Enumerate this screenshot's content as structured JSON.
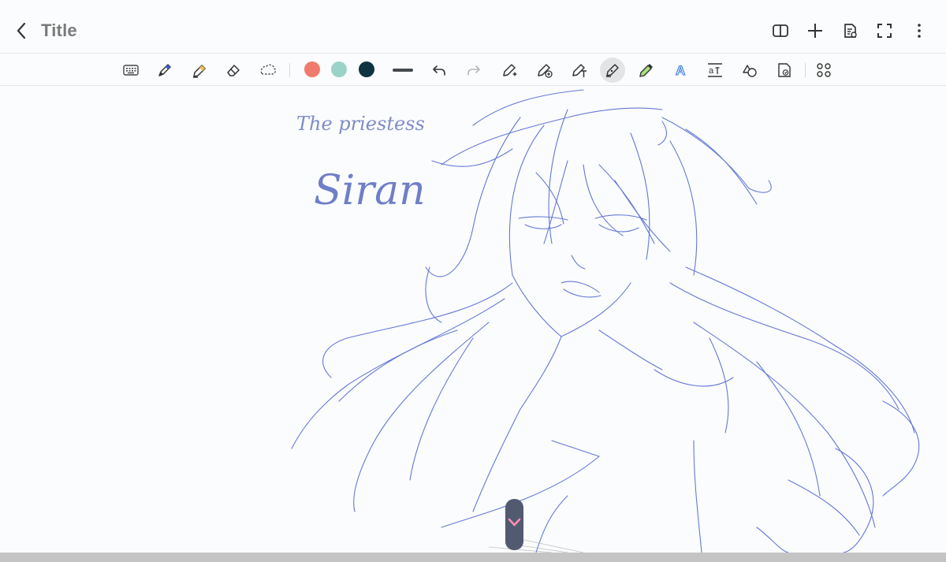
{
  "header": {
    "title": "Title",
    "actions": [
      "book-icon",
      "add-icon",
      "page-settings-icon",
      "fullscreen-icon",
      "more-icon"
    ]
  },
  "toolbar": {
    "tools": [
      "keyboard-icon",
      "pen-icon",
      "highlighter-icon",
      "eraser-icon",
      "lasso-icon"
    ],
    "colors": [
      "#f07a6b",
      "#9bd3c9",
      "#0f3340"
    ],
    "stroke_color": "#444950",
    "right_tools": [
      "undo-icon",
      "redo-icon",
      "pen-sparkle-icon",
      "pen-plus-icon",
      "pen-text-icon",
      "fountain-pen-icon",
      "marker-icon",
      "handwriting-icon",
      "text-input-icon",
      "shapes-icon",
      "insert-image-icon",
      "more-tools-icon"
    ],
    "active_tool": "fountain-pen-icon"
  },
  "canvas": {
    "handwriting_line1": "The priestess",
    "handwriting_line2": "Siran",
    "ink_color": "#4a63d0",
    "title_ink_color": "#7f8cc8"
  },
  "scroll_thumb": {
    "accent": "#ff8fb2"
  }
}
